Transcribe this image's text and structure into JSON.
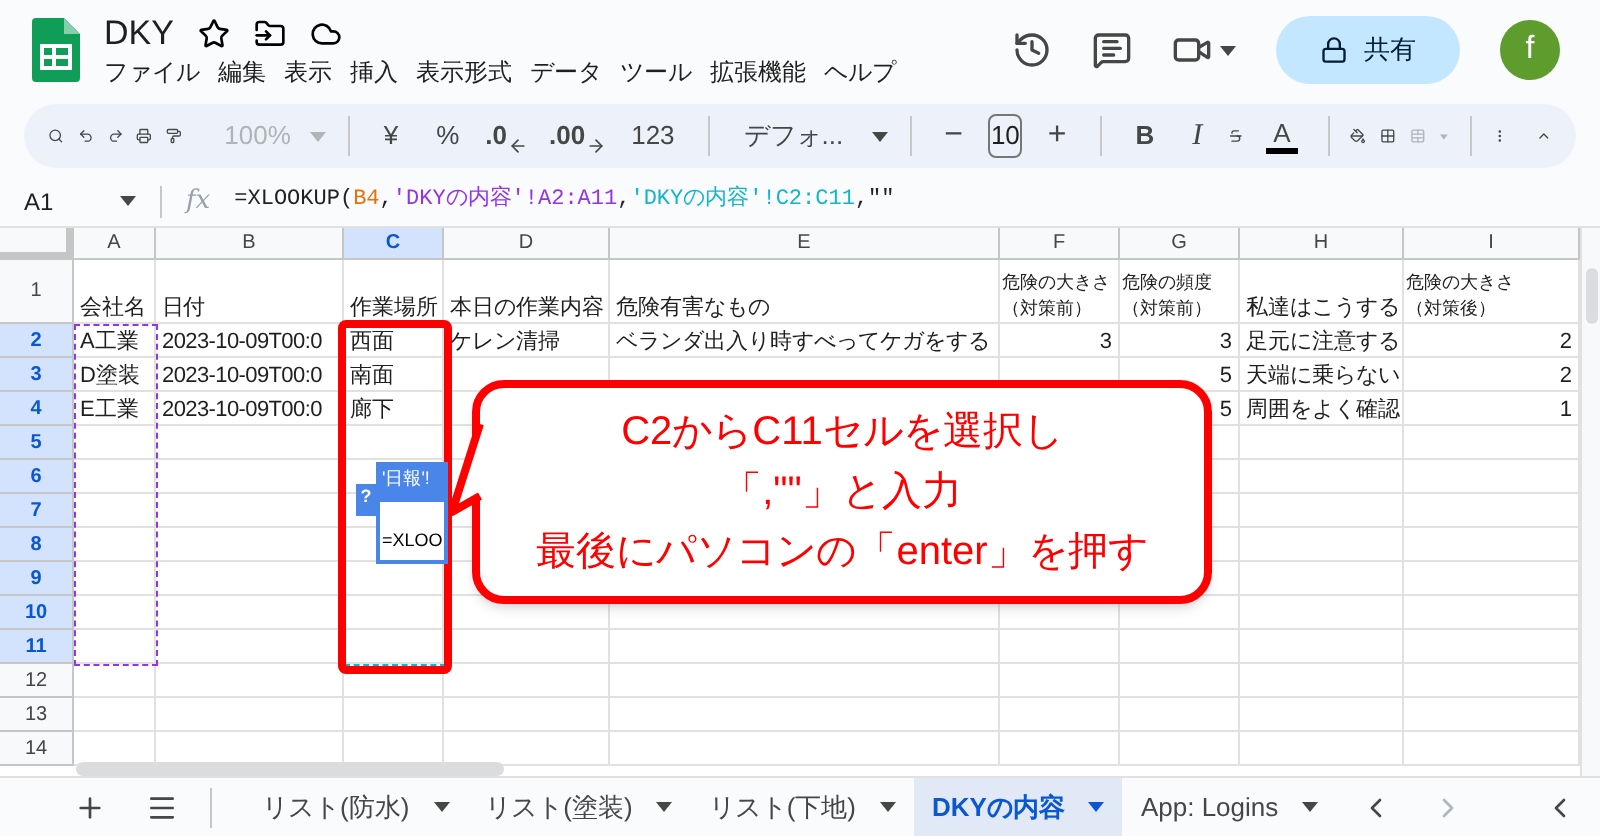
{
  "doc": {
    "title": "DKY"
  },
  "menu": [
    "ファイル",
    "編集",
    "表示",
    "挿入",
    "表示形式",
    "データ",
    "ツール",
    "拡張機能",
    "ヘルプ"
  ],
  "share_button": {
    "label": "共有"
  },
  "avatar": {
    "letter": "f"
  },
  "toolbar": {
    "zoom": "100%",
    "currency": "¥",
    "percent": "%",
    "decrease_decimal": ".0",
    "increase_decimal": ".00",
    "number_format": "123",
    "font": "デフォ...",
    "minus": "−",
    "font_size": "10",
    "plus": "+",
    "bold": "B",
    "italic": "I",
    "text_color": "A"
  },
  "name_box": "A1",
  "fx_label": "fx",
  "formula": [
    {
      "text": "=XLOOKUP(",
      "color": "#202124"
    },
    {
      "text": "B4",
      "color": "#e8710a"
    },
    {
      "text": ",",
      "color": "#202124"
    },
    {
      "text": "'DKYの内容'!A2:A11",
      "color": "#9334e6"
    },
    {
      "text": ",",
      "color": "#202124"
    },
    {
      "text": "'DKYの内容'!C2:C11",
      "color": "#12b5cb"
    },
    {
      "text": ",\"\"",
      "color": "#202124"
    }
  ],
  "columns": [
    {
      "label": "A",
      "selected": false
    },
    {
      "label": "B",
      "selected": false
    },
    {
      "label": "C",
      "selected": true
    },
    {
      "label": "D",
      "selected": false
    },
    {
      "label": "E",
      "selected": false
    },
    {
      "label": "F",
      "selected": false
    },
    {
      "label": "G",
      "selected": false
    },
    {
      "label": "H",
      "selected": false
    },
    {
      "label": "I",
      "selected": false
    }
  ],
  "rows": [
    {
      "number": "1",
      "selected": false,
      "cells": {
        "A": {
          "text": "会社名"
        },
        "B": {
          "text": "日付"
        },
        "C": {
          "text": "作業場所"
        },
        "D": {
          "text": "本日の作業内容"
        },
        "E": {
          "text": "危険有害なもの"
        },
        "F": {
          "lines": [
            "危険の大きさ",
            "（対策前）"
          ]
        },
        "G": {
          "lines": [
            "危険の頻度",
            "（対策前）"
          ]
        },
        "H": {
          "text": "私達はこうする"
        },
        "I": {
          "lines": [
            "危険の大きさ",
            "（対策後）"
          ]
        }
      }
    },
    {
      "number": "2",
      "selected": true,
      "cells": {
        "A": {
          "text": "A工業"
        },
        "B": {
          "text": "2023-10-09T00:0"
        },
        "C": {
          "text": "西面"
        },
        "D": {
          "text": "ケレン清掃"
        },
        "E": {
          "text": "ベランダ出入り時すべってケガをする"
        },
        "F": {
          "text": "3",
          "kind": "number"
        },
        "G": {
          "text": "3",
          "kind": "number"
        },
        "H": {
          "text": "足元に注意する"
        },
        "I": {
          "text": "2",
          "kind": "number"
        }
      }
    },
    {
      "number": "3",
      "selected": true,
      "cells": {
        "A": {
          "text": "D塗装"
        },
        "B": {
          "text": "2023-10-09T00:0"
        },
        "C": {
          "text": "南面"
        },
        "G": {
          "text": "5",
          "kind": "number"
        },
        "H": {
          "text": "天端に乗らない"
        },
        "I": {
          "text": "2",
          "kind": "number"
        }
      }
    },
    {
      "number": "4",
      "selected": true,
      "cells": {
        "A": {
          "text": "E工業"
        },
        "B": {
          "text": "2023-10-09T00:0"
        },
        "C": {
          "text": "廊下"
        },
        "G": {
          "text": "5",
          "kind": "number"
        },
        "H": {
          "text": "周囲をよく確認"
        },
        "I": {
          "text": "1",
          "kind": "number"
        }
      }
    },
    {
      "number": "5",
      "selected": true,
      "cells": {}
    },
    {
      "number": "6",
      "selected": true,
      "cells": {}
    },
    {
      "number": "7",
      "selected": true,
      "cells": {}
    },
    {
      "number": "8",
      "selected": true,
      "cells": {}
    },
    {
      "number": "9",
      "selected": true,
      "cells": {}
    },
    {
      "number": "10",
      "selected": true,
      "cells": {}
    },
    {
      "number": "11",
      "selected": true,
      "cells": {}
    },
    {
      "number": "12",
      "selected": false,
      "cells": {}
    },
    {
      "number": "13",
      "selected": false,
      "cells": {}
    },
    {
      "number": "14",
      "selected": false,
      "cells": {}
    }
  ],
  "formula_hint": {
    "tooltip": "'日報'!",
    "help": "?",
    "preview": "=XLOO"
  },
  "callout": {
    "lines": [
      "C2からC11セルを選択し",
      "「,\"\"」と入力",
      "最後にパソコンの「enter」を押す"
    ]
  },
  "sheet_tabs": [
    {
      "label": "リスト(防水)",
      "selected": false
    },
    {
      "label": "リスト(塗装)",
      "selected": false
    },
    {
      "label": "リスト(下地)",
      "selected": false
    },
    {
      "label": "DKYの内容",
      "selected": true
    },
    {
      "label": "App: Logins",
      "selected": false
    }
  ]
}
